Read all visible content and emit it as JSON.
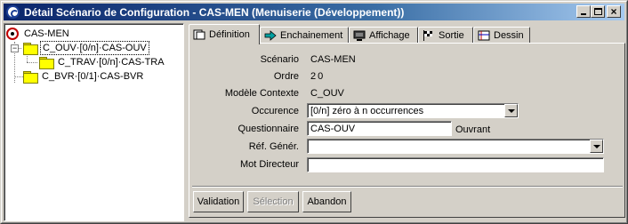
{
  "window": {
    "title": "Détail Scénario de Configuration - CAS-MEN (Menuiserie (Développement))",
    "controls": {
      "minimize": "_",
      "maximize": "□",
      "close": "×"
    }
  },
  "tree": {
    "root": {
      "label": "CAS-MEN",
      "icon": "scenario-root-icon"
    },
    "nodes": [
      {
        "label": "C_OUV·[0/n]·CAS-OUV",
        "expander": "-",
        "selected": true
      },
      {
        "label": "C_TRAV·[0/n]·CAS-TRA"
      },
      {
        "label": "C_BVR·[0/1]·CAS-BVR"
      }
    ]
  },
  "tabs": [
    {
      "label": "Définition",
      "icon": "definition-icon",
      "active": true
    },
    {
      "label": "Enchainement",
      "icon": "arrow-right-icon"
    },
    {
      "label": "Affichage",
      "icon": "monitor-icon"
    },
    {
      "label": "Sortie",
      "icon": "checkered-flag-icon"
    },
    {
      "label": "Dessin",
      "icon": "drawing-icon"
    }
  ],
  "form": {
    "scenario": {
      "label": "Scénario",
      "value": "CAS-MEN"
    },
    "ordre": {
      "label": "Ordre",
      "value": "20"
    },
    "modele": {
      "label": "Modèle Contexte",
      "value": "C_OUV"
    },
    "occurence": {
      "label": "Occurence",
      "value": "[0/n] zéro à n occurrences"
    },
    "questionnaire": {
      "label": "Questionnaire",
      "value": "CAS-OUV",
      "suffix": "Ouvrant"
    },
    "ref_gener": {
      "label": "Réf. Génér.",
      "value": ""
    },
    "mot_directeur": {
      "label": "Mot Directeur",
      "value": ""
    }
  },
  "buttons": {
    "validation": "Validation",
    "selection": "Sélection",
    "abandon": "Abandon"
  },
  "colors": {
    "titlebar_start": "#0a246a",
    "titlebar_end": "#a6caf0",
    "face": "#d4d0c8",
    "folder": "#ffff00"
  }
}
